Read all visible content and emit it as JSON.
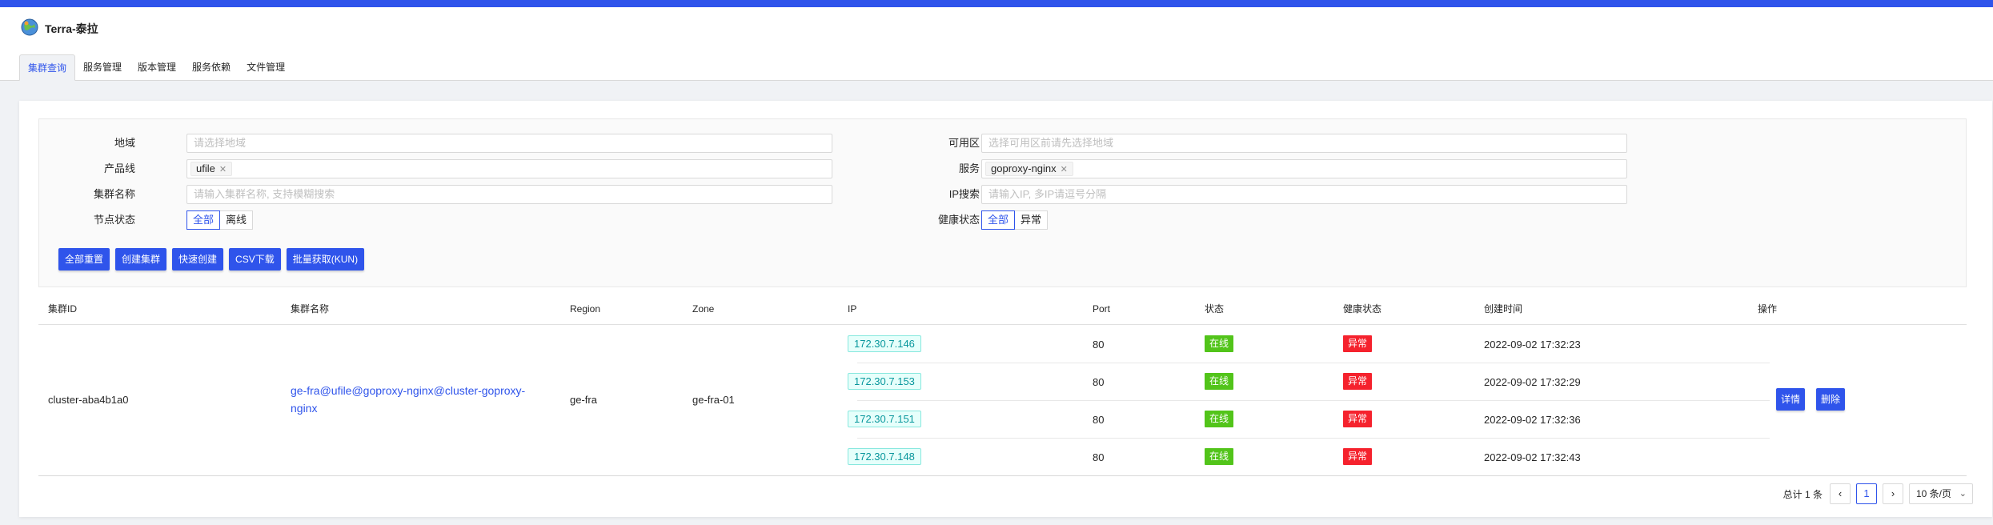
{
  "app": {
    "title": "Terra-泰拉"
  },
  "tabs": [
    {
      "label": "集群查询"
    },
    {
      "label": "服务管理"
    },
    {
      "label": "版本管理"
    },
    {
      "label": "服务依赖"
    },
    {
      "label": "文件管理"
    }
  ],
  "filters": {
    "region": {
      "label": "地域",
      "placeholder": "请选择地域"
    },
    "zone": {
      "label": "可用区",
      "placeholder": "选择可用区前请先选择地域"
    },
    "product": {
      "label": "产品线",
      "tag": "ufile"
    },
    "service": {
      "label": "服务",
      "tag": "goproxy-nginx"
    },
    "cluster_name": {
      "label": "集群名称",
      "placeholder": "请输入集群名称, 支持模糊搜索"
    },
    "ip_search": {
      "label": "IP搜索",
      "placeholder": "请输入IP, 多IP请逗号分隔"
    },
    "node_status": {
      "label": "节点状态",
      "options": [
        "全部",
        "离线"
      ],
      "selected": "全部"
    },
    "health_status": {
      "label": "健康状态",
      "options": [
        "全部",
        "异常"
      ],
      "selected": "全部"
    }
  },
  "actions": {
    "reset": "全部重置",
    "create": "创建集群",
    "quick_create": "快速创建",
    "csv": "CSV下载",
    "batch": "批量获取(KUN)"
  },
  "table": {
    "headers": [
      "集群ID",
      "集群名称",
      "Region",
      "Zone",
      "IP",
      "Port",
      "状态",
      "健康状态",
      "创建时间",
      "操作"
    ],
    "cluster": {
      "id": "cluster-aba4b1a0",
      "name": "ge-fra@ufile@goproxy-nginx@cluster-goproxy-nginx",
      "region": "ge-fra",
      "zone": "ge-fra-01",
      "nodes": [
        {
          "ip": "172.30.7.146",
          "port": "80",
          "status": "在线",
          "health": "异常",
          "created": "2022-09-02 17:32:23"
        },
        {
          "ip": "172.30.7.153",
          "port": "80",
          "status": "在线",
          "health": "异常",
          "created": "2022-09-02 17:32:29"
        },
        {
          "ip": "172.30.7.151",
          "port": "80",
          "status": "在线",
          "health": "异常",
          "created": "2022-09-02 17:32:36"
        },
        {
          "ip": "172.30.7.148",
          "port": "80",
          "status": "在线",
          "health": "异常",
          "created": "2022-09-02 17:32:43"
        }
      ],
      "detail_label": "详情",
      "delete_label": "删除"
    }
  },
  "pagination": {
    "total_label": "总计 1 条",
    "prev": "‹",
    "current": "1",
    "next": "›",
    "page_size": "10 条/页"
  },
  "colors": {
    "primary": "#2f54eb",
    "online": "#52c41a",
    "abnormal": "#f5222d",
    "ip_tag": "#08979c"
  }
}
